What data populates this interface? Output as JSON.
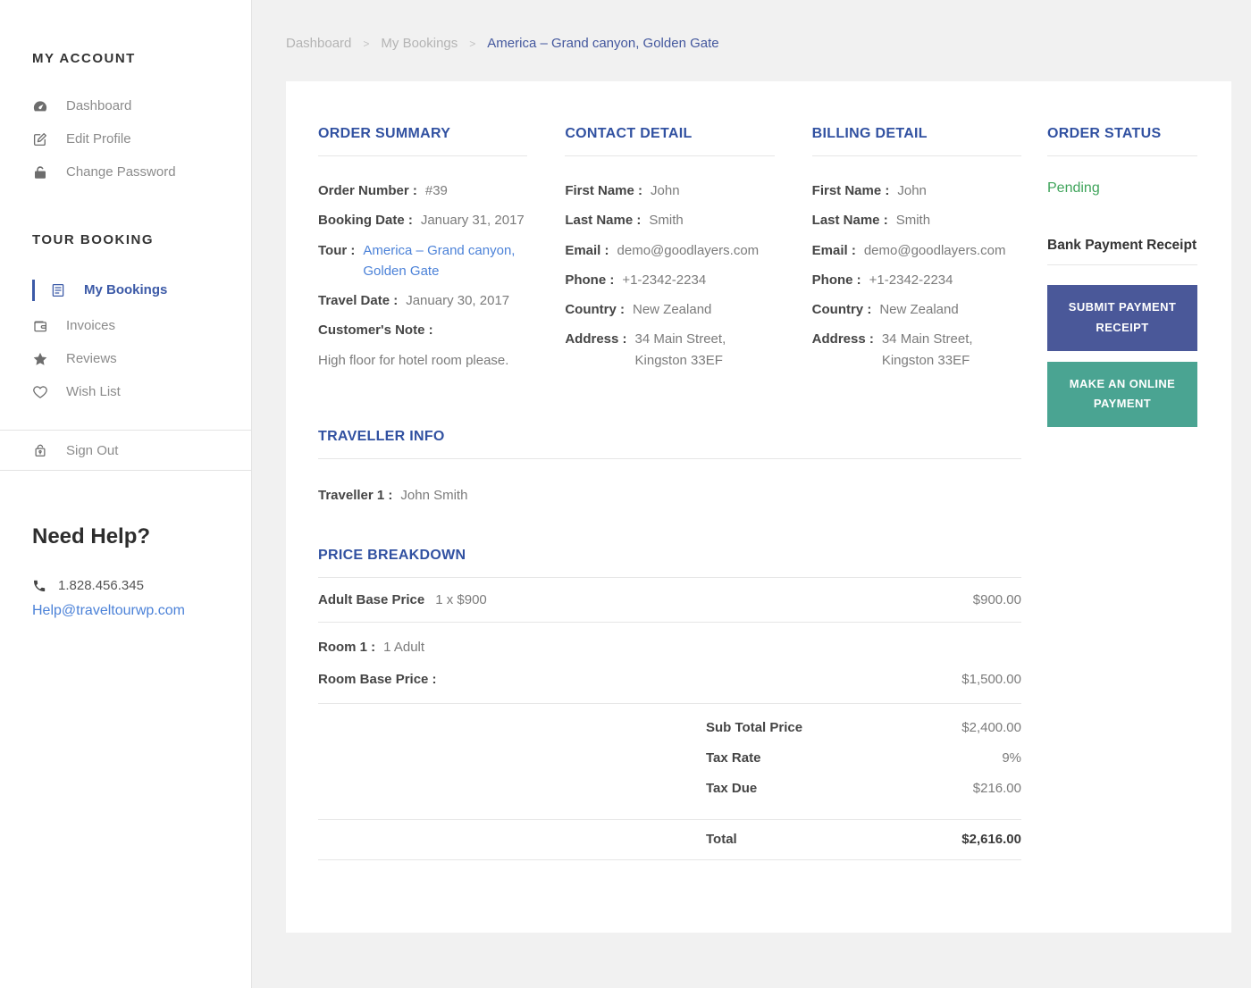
{
  "colors": {
    "accent_blue": "#3151a1",
    "link_blue": "#4c82d8",
    "active_item_blue": "#3c5aa7",
    "pending_green": "#3fa45b",
    "submit_button_bg": "#4a5899",
    "payment_button_bg": "#4aa492",
    "page_bg": "#f1f1f1"
  },
  "sidebar": {
    "account_heading": "MY ACCOUNT",
    "account_items": [
      {
        "label": "Dashboard",
        "icon": "dashboard-icon"
      },
      {
        "label": "Edit Profile",
        "icon": "edit-icon"
      },
      {
        "label": "Change Password",
        "icon": "lock-icon"
      }
    ],
    "booking_heading": "TOUR BOOKING",
    "booking_items": [
      {
        "label": "My Bookings",
        "icon": "bookings-icon",
        "active": true
      },
      {
        "label": "Invoices",
        "icon": "wallet-icon"
      },
      {
        "label": "Reviews",
        "icon": "star-icon"
      },
      {
        "label": "Wish List",
        "icon": "heart-icon"
      }
    ],
    "signout_label": "Sign Out",
    "help": {
      "heading": "Need Help?",
      "phone": "1.828.456.345",
      "email": "Help@traveltourwp.com"
    }
  },
  "breadcrumb": {
    "items": [
      {
        "label": "Dashboard"
      },
      {
        "label": "My Bookings"
      }
    ],
    "separator": ">",
    "current": "America – Grand canyon, Golden Gate"
  },
  "order_summary": {
    "title": "ORDER SUMMARY",
    "rows": [
      {
        "label": "Order Number :",
        "value": "#39"
      },
      {
        "label": "Booking Date :",
        "value": "January 31, 2017"
      },
      {
        "label": "Tour :",
        "value": "America – Grand canyon, Golden Gate"
      },
      {
        "label": "Travel Date :",
        "value": "January 30, 2017"
      },
      {
        "label": "Customer's Note :",
        "value": ""
      }
    ],
    "note": "High floor for hotel room please."
  },
  "contact_detail": {
    "title": "CONTACT DETAIL",
    "rows": [
      {
        "label": "First Name :",
        "value": "John"
      },
      {
        "label": "Last Name :",
        "value": "Smith"
      },
      {
        "label": "Email :",
        "value": "demo@goodlayers.com"
      },
      {
        "label": "Phone :",
        "value": "+1-2342-2234"
      },
      {
        "label": "Country :",
        "value": "New Zealand"
      },
      {
        "label": "Address :",
        "value": "34 Main Street, Kingston 33EF"
      }
    ]
  },
  "billing_detail": {
    "title": "BILLING DETAIL",
    "rows": [
      {
        "label": "First Name :",
        "value": "John"
      },
      {
        "label": "Last Name :",
        "value": "Smith"
      },
      {
        "label": "Email :",
        "value": "demo@goodlayers.com"
      },
      {
        "label": "Phone :",
        "value": "+1-2342-2234"
      },
      {
        "label": "Country :",
        "value": "New Zealand"
      },
      {
        "label": "Address :",
        "value": "34 Main Street, Kingston 33EF"
      }
    ]
  },
  "order_status": {
    "title": "ORDER STATUS",
    "status": "Pending",
    "receipt_label": "Bank Payment Receipt",
    "submit_button": "SUBMIT PAYMENT RECEIPT",
    "payment_button": "MAKE AN ONLINE PAYMENT"
  },
  "traveller_info": {
    "title": "TRAVELLER INFO",
    "rows": [
      {
        "label": "Traveller 1 :",
        "value": "John Smith"
      }
    ]
  },
  "price_breakdown": {
    "title": "PRICE BREAKDOWN",
    "adult_row": {
      "label": "Adult Base Price",
      "qty": "1 x $900",
      "amount": "$900.00"
    },
    "room_rows": [
      {
        "label": "Room 1 :",
        "value": "1 Adult"
      },
      {
        "label": "Room Base Price :",
        "amount": "$1,500.00"
      }
    ],
    "totals": [
      {
        "label": "Sub Total Price",
        "value": "$2,400.00"
      },
      {
        "label": "Tax Rate",
        "value": "9%"
      },
      {
        "label": "Tax Due",
        "value": "$216.00"
      }
    ],
    "total": {
      "label": "Total",
      "value": "$2,616.00"
    }
  }
}
